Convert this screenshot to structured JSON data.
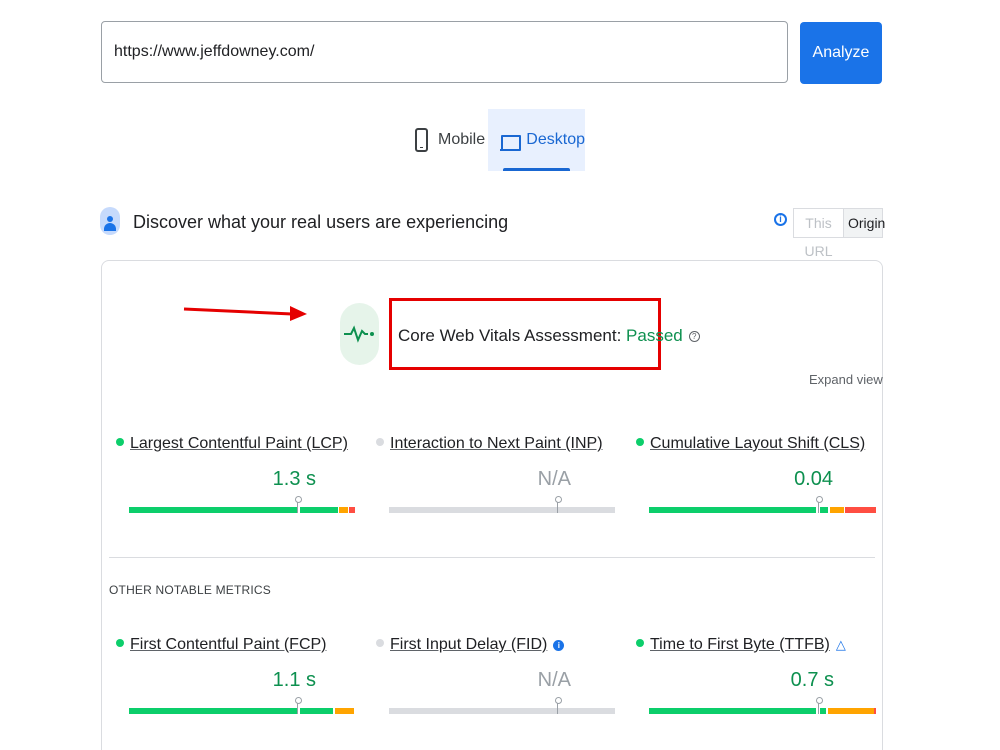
{
  "url_bar": {
    "value": "https://www.jeffdowney.com/",
    "analyze_label": "Analyze"
  },
  "tabs": [
    {
      "label": "Mobile",
      "icon": "phone-icon",
      "active": false
    },
    {
      "label": "Desktop",
      "icon": "laptop-icon",
      "active": true
    }
  ],
  "discover": {
    "title": "Discover what your real users are experiencing",
    "toggle": {
      "this_url": "This URL",
      "origin": "Origin",
      "selected": "Origin"
    }
  },
  "assessment": {
    "label": "Core Web Vitals Assessment: ",
    "status": "Passed"
  },
  "expand_view": "Expand view",
  "core_metrics": [
    {
      "name": "Largest Contentful Paint (LCP)",
      "value": "1.3 s",
      "rating": "good"
    },
    {
      "name": "Interaction to Next Paint (INP)",
      "value": "N/A",
      "rating": "na"
    },
    {
      "name": "Cumulative Layout Shift (CLS)",
      "value": "0.04",
      "rating": "good"
    }
  ],
  "other_title": "OTHER NOTABLE METRICS",
  "other_metrics": [
    {
      "name": "First Contentful Paint (FCP)",
      "value": "1.1 s",
      "rating": "good"
    },
    {
      "name": "First Input Delay (FID)",
      "value": "N/A",
      "rating": "na"
    },
    {
      "name": "Time to First Byte (TTFB)",
      "value": "0.7 s",
      "rating": "good"
    }
  ],
  "colors": {
    "accent": "#1a73e8",
    "good": "#0cce6b",
    "needs_improvement": "#ffa400",
    "poor": "#ff4e42",
    "na_bar": "#dadce0",
    "annotation_red": "#e50000"
  }
}
